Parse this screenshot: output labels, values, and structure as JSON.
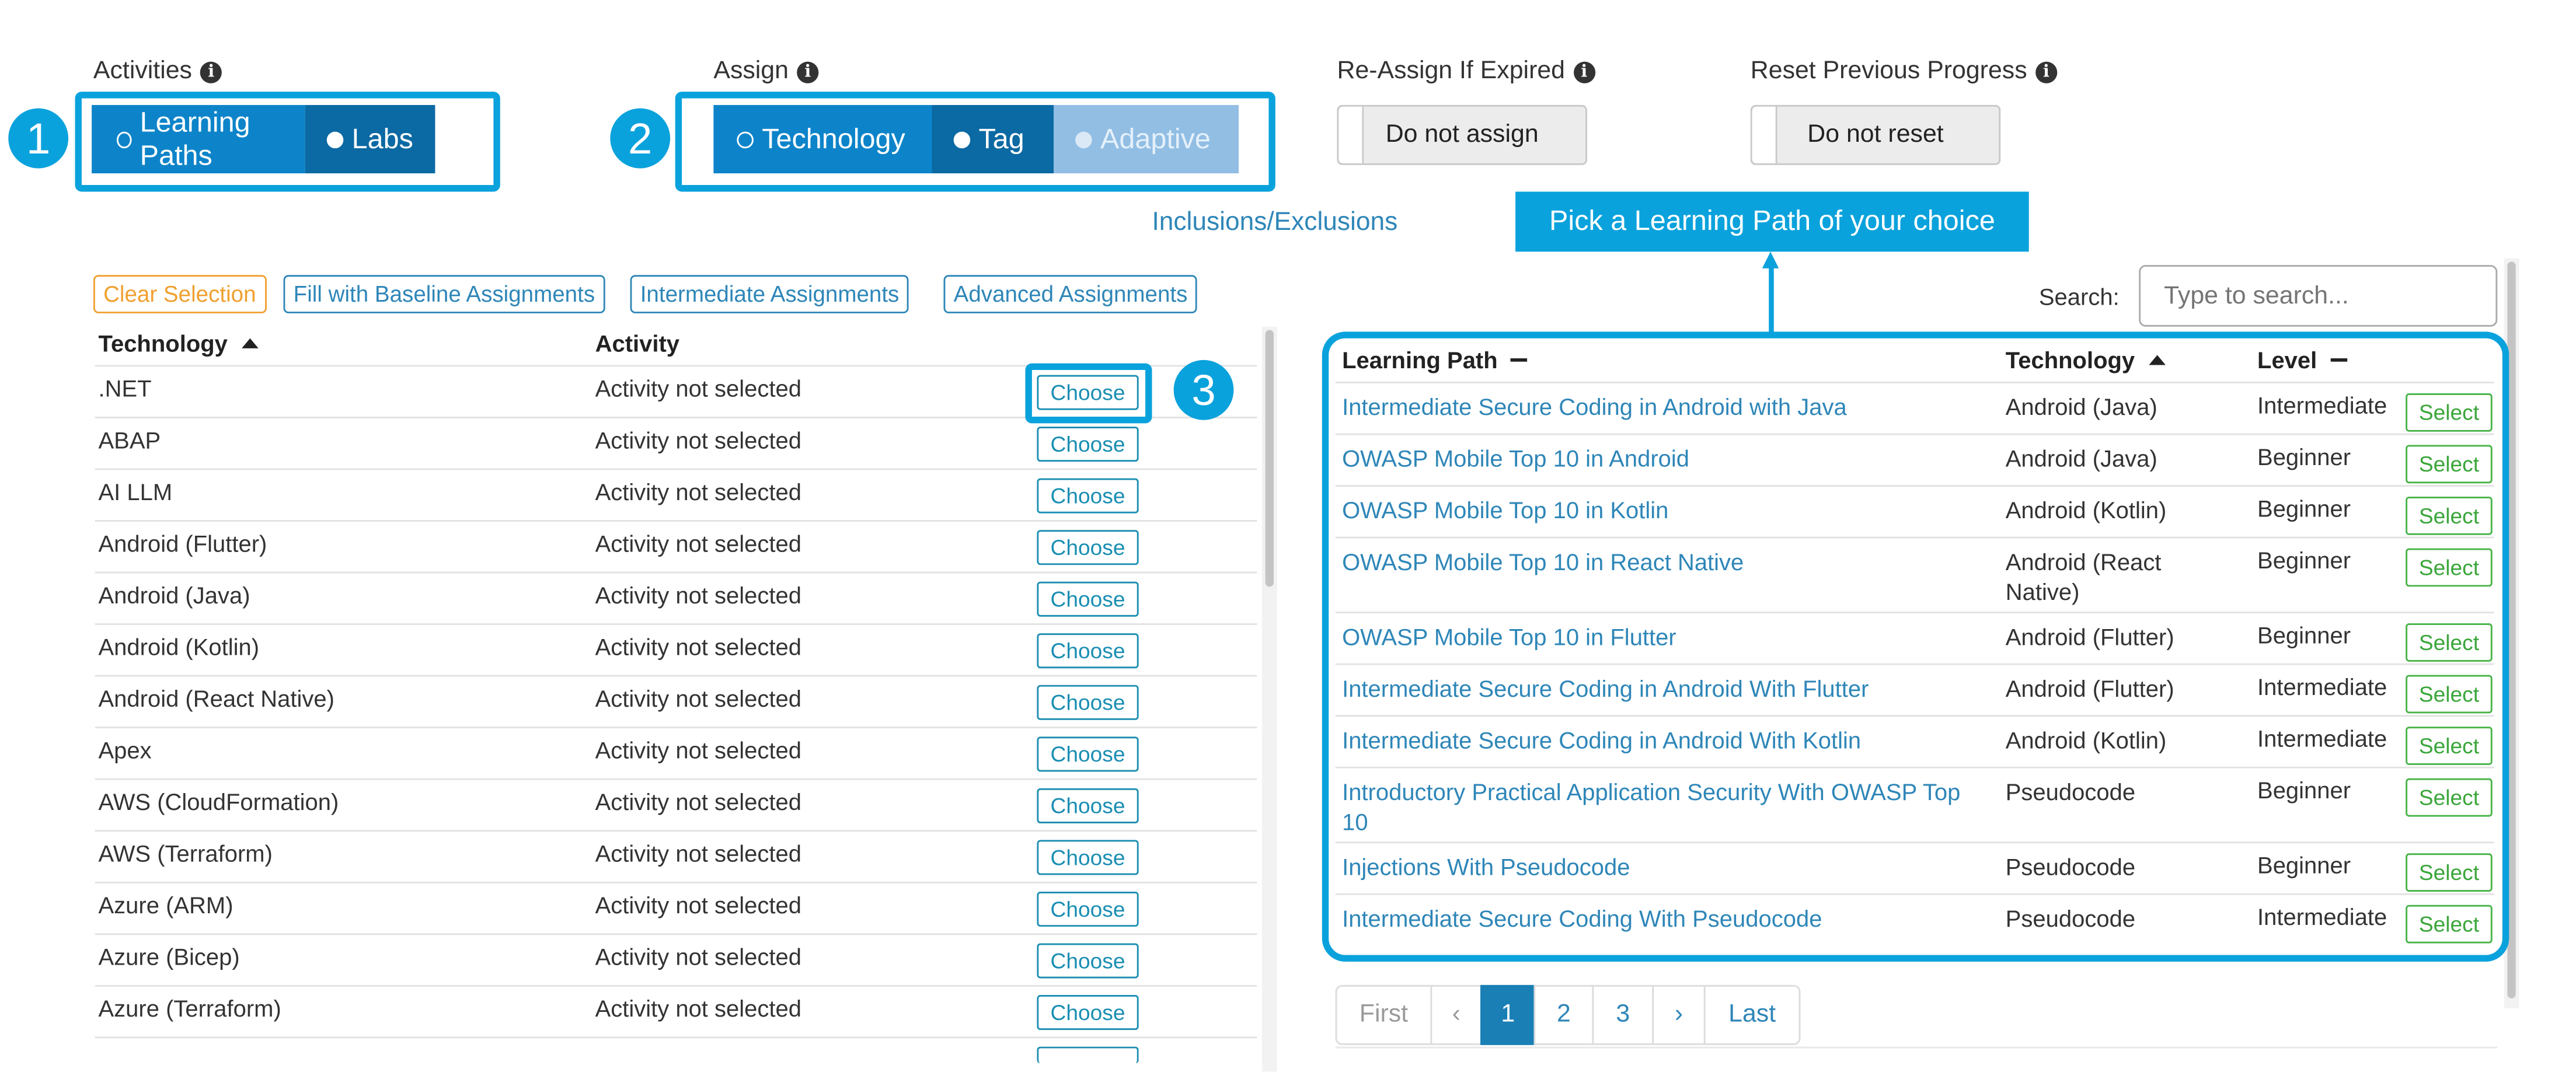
{
  "header": {
    "activities": {
      "label": "Activities",
      "options": [
        "Learning Paths",
        "Labs"
      ]
    },
    "assign": {
      "label": "Assign",
      "options": [
        "Technology",
        "Tag",
        "Adaptive"
      ]
    },
    "reassign": {
      "label": "Re-Assign If Expired",
      "button": "Do not assign"
    },
    "reset": {
      "label": "Reset Previous Progress",
      "button": "Do not reset"
    },
    "info_glyph": "i"
  },
  "callouts": {
    "one": "1",
    "two": "2",
    "three": "3",
    "pick_banner": "Pick a Learning Path of your choice"
  },
  "inclusions_link": "Inclusions/Exclusions",
  "left": {
    "buttons": {
      "clear": "Clear Selection",
      "baseline": "Fill with Baseline Assignments",
      "intermediate": "Intermediate Assignments",
      "advanced": "Advanced Assignments"
    },
    "columns": {
      "technology": "Technology",
      "activity": "Activity"
    },
    "choose_label": "Choose",
    "rows": [
      {
        "tech": ".NET",
        "activity": "Activity not selected"
      },
      {
        "tech": "ABAP",
        "activity": "Activity not selected"
      },
      {
        "tech": "AI LLM",
        "activity": "Activity not selected"
      },
      {
        "tech": "Android (Flutter)",
        "activity": "Activity not selected"
      },
      {
        "tech": "Android (Java)",
        "activity": "Activity not selected"
      },
      {
        "tech": "Android (Kotlin)",
        "activity": "Activity not selected"
      },
      {
        "tech": "Android (React Native)",
        "activity": "Activity not selected"
      },
      {
        "tech": "Apex",
        "activity": "Activity not selected"
      },
      {
        "tech": "AWS (CloudFormation)",
        "activity": "Activity not selected"
      },
      {
        "tech": "AWS (Terraform)",
        "activity": "Activity not selected"
      },
      {
        "tech": "Azure (ARM)",
        "activity": "Activity not selected"
      },
      {
        "tech": "Azure (Bicep)",
        "activity": "Activity not selected"
      },
      {
        "tech": "Azure (Terraform)",
        "activity": "Activity not selected"
      }
    ]
  },
  "right": {
    "search_label": "Search:",
    "search_placeholder": "Type to search...",
    "columns": {
      "path": "Learning Path",
      "technology": "Technology",
      "level": "Level"
    },
    "select_label": "Select",
    "rows": [
      {
        "path": "Intermediate Secure Coding in Android with Java",
        "tech": "Android (Java)",
        "level": "Intermediate"
      },
      {
        "path": "OWASP Mobile Top 10 in Android",
        "tech": "Android (Java)",
        "level": "Beginner"
      },
      {
        "path": "OWASP Mobile Top 10 in Kotlin",
        "tech": "Android (Kotlin)",
        "level": "Beginner"
      },
      {
        "path": "OWASP Mobile Top 10 in React Native",
        "tech": "Android (React Native)",
        "level": "Beginner"
      },
      {
        "path": "OWASP Mobile Top 10 in Flutter",
        "tech": "Android (Flutter)",
        "level": "Beginner"
      },
      {
        "path": "Intermediate Secure Coding in Android With Flutter",
        "tech": "Android (Flutter)",
        "level": "Intermediate"
      },
      {
        "path": "Intermediate Secure Coding in Android With Kotlin",
        "tech": "Android (Kotlin)",
        "level": "Intermediate"
      },
      {
        "path": "Introductory Practical Application Security With OWASP Top 10",
        "tech": "Pseudocode",
        "level": "Beginner"
      },
      {
        "path": "Injections With Pseudocode",
        "tech": "Pseudocode",
        "level": "Beginner"
      },
      {
        "path": "Intermediate Secure Coding With Pseudocode",
        "tech": "Pseudocode",
        "level": "Intermediate"
      }
    ],
    "pagination": {
      "first": "First",
      "prev": "‹",
      "pages": [
        "1",
        "2",
        "3"
      ],
      "next": "›",
      "last": "Last",
      "current": "1"
    }
  },
  "colors": {
    "accent": "#0aa2dc",
    "toggle_active": "#0d84c9",
    "toggle_dark": "#0b69a3",
    "link": "#2e86b8",
    "select_green": "#3aa63a",
    "clear_orange": "#f0a030"
  }
}
